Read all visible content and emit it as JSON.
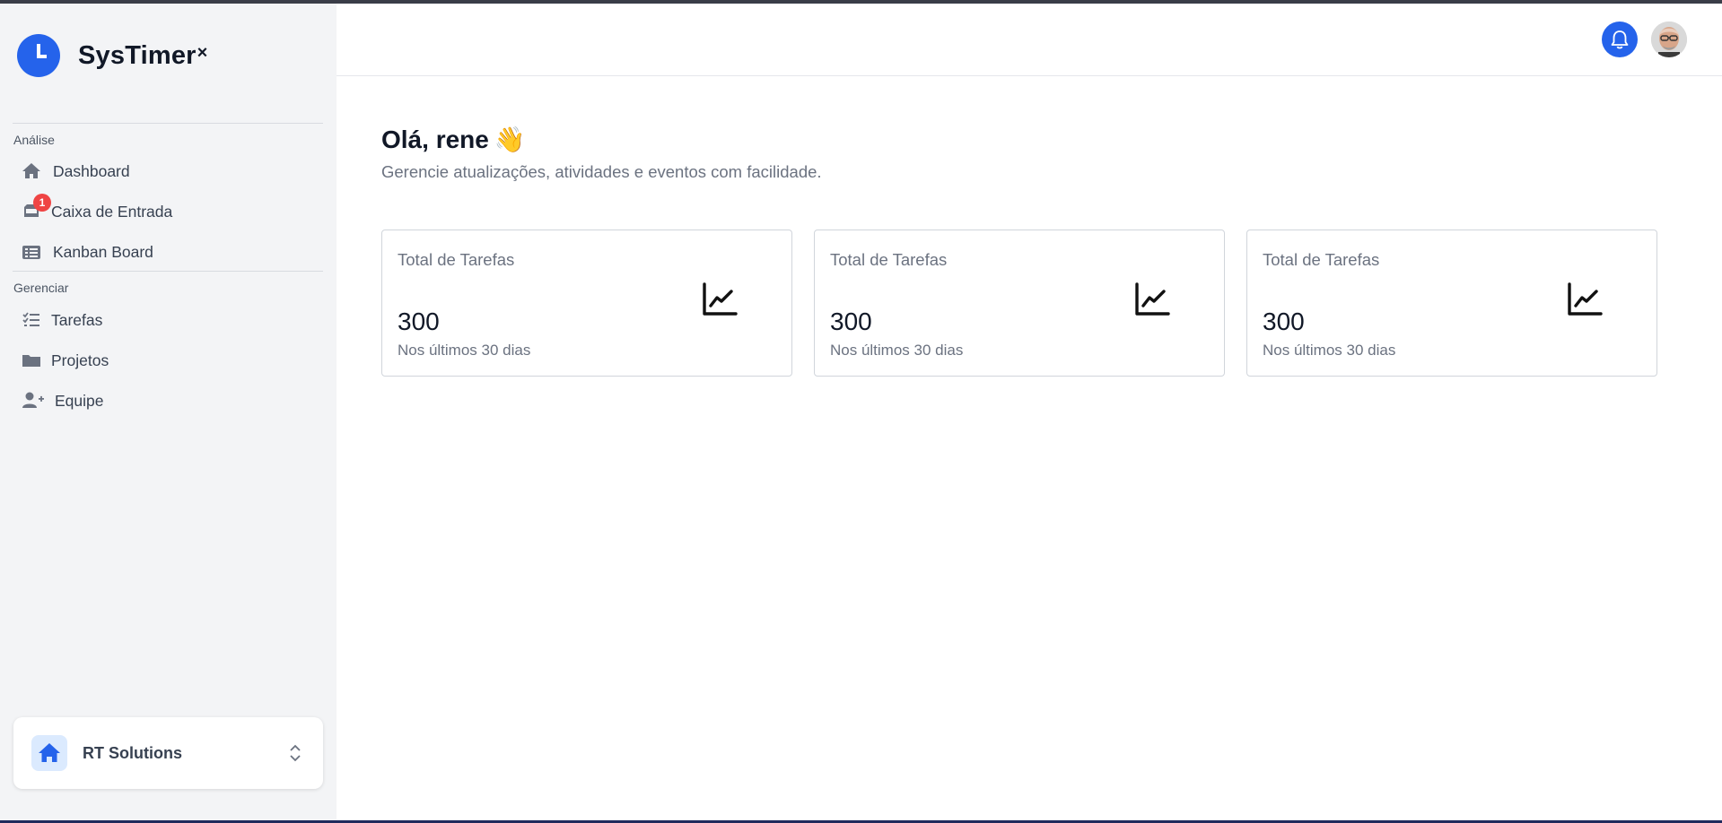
{
  "app": {
    "name": "SysTimer",
    "name_suffix": "×"
  },
  "sidebar": {
    "sections": [
      {
        "label": "Análise",
        "items": [
          {
            "label": "Dashboard",
            "icon": "home-icon"
          },
          {
            "label": "Caixa de Entrada",
            "icon": "inbox-icon",
            "badge": "1"
          },
          {
            "label": "Kanban Board",
            "icon": "list-icon"
          }
        ]
      },
      {
        "label": "Gerenciar",
        "items": [
          {
            "label": "Tarefas",
            "icon": "tasks-icon"
          },
          {
            "label": "Projetos",
            "icon": "folder-icon"
          },
          {
            "label": "Equipe",
            "icon": "add-user-icon"
          }
        ]
      }
    ],
    "workspace": {
      "name": "RT Solutions",
      "icon": "home-icon"
    }
  },
  "header": {
    "notification_icon": "bell-icon",
    "avatar": "user-avatar"
  },
  "main": {
    "greeting": "Olá, rene",
    "greeting_emoji": "👋",
    "subtitle": "Gerencie atualizações, atividades e eventos com facilidade.",
    "cards": [
      {
        "title": "Total de Tarefas",
        "value": "300",
        "subtitle": "Nos últimos 30 dias",
        "icon": "trend-up-icon"
      },
      {
        "title": "Total de Tarefas",
        "value": "300",
        "subtitle": "Nos últimos 30 dias",
        "icon": "trend-up-icon"
      },
      {
        "title": "Total de Tarefas",
        "value": "300",
        "subtitle": "Nos últimos 30 dias",
        "icon": "trend-up-icon"
      }
    ]
  },
  "colors": {
    "accent": "#2563eb",
    "sidebar_bg": "#f3f4f6",
    "badge": "#ef4444",
    "icon_gray": "#6b7280"
  }
}
